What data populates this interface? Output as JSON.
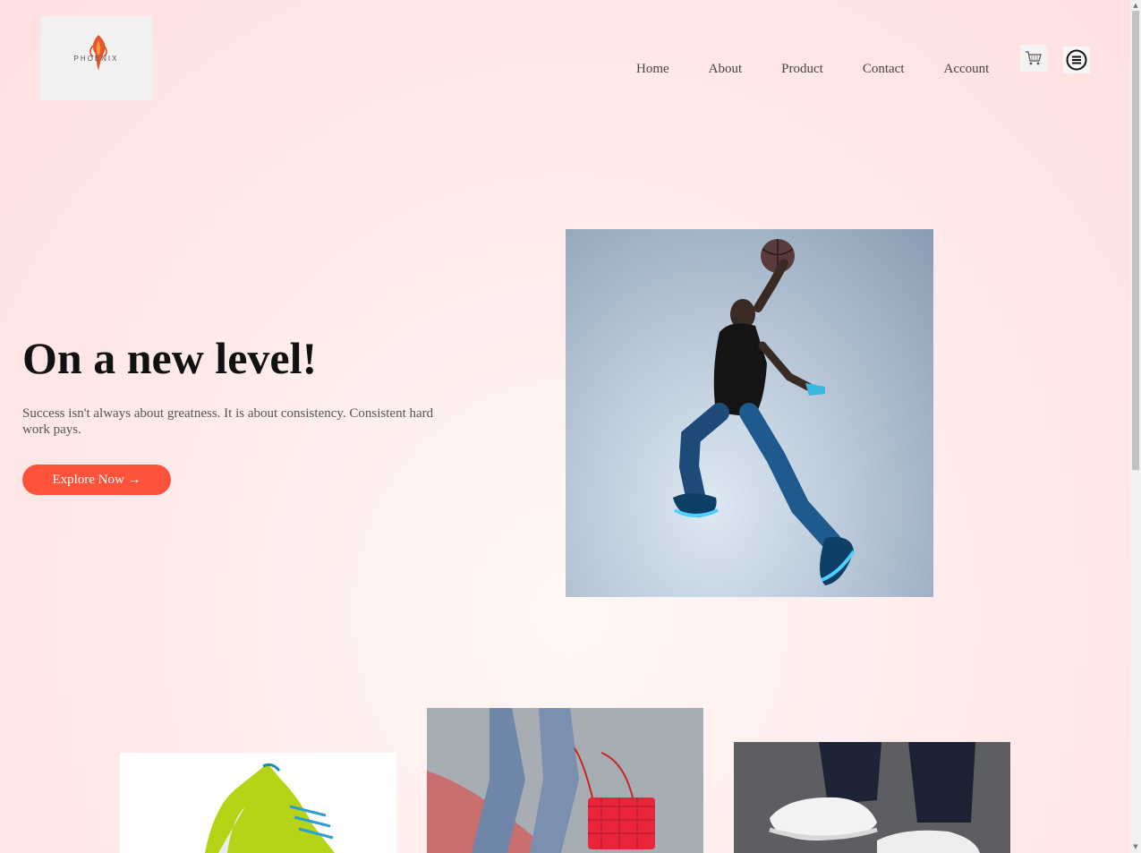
{
  "brand": {
    "logo_text": "PHOENIX",
    "accent_color": "#ff523b"
  },
  "nav": {
    "items": [
      {
        "label": "Home"
      },
      {
        "label": "About"
      },
      {
        "label": "Product"
      },
      {
        "label": "Contact"
      },
      {
        "label": "Account"
      }
    ]
  },
  "icons": {
    "cart": "cart-icon",
    "menu": "menu-icon"
  },
  "hero": {
    "title": "On a new level!",
    "text": "Success isn't always about greatness. It is about consistency. Consistent hard work pays.",
    "button_label": "Explore Now →",
    "image": "basketball-player-image"
  },
  "categories": [
    {
      "image": "green-sneaker-image"
    },
    {
      "image": "red-handbag-image"
    },
    {
      "image": "white-sneakers-image"
    }
  ]
}
